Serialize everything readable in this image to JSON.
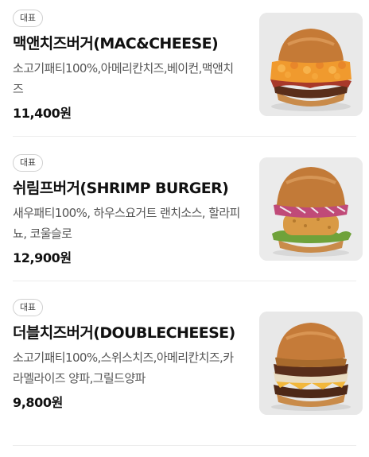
{
  "menu_items": [
    {
      "badge": "대표",
      "name": "맥앤치즈버거(MAC&CHEESE)",
      "description": "소고기패티100%,아메리칸치즈,베이컨,맥앤치즈",
      "price": "11,400원",
      "image_icon": "burger-mac-and-cheese-photo"
    },
    {
      "badge": "대표",
      "name": "쉬림프버거(SHRIMP BURGER)",
      "description": "새우패티100%, 하우스요거트 랜치소스, 할라피뇨, 코울슬로",
      "price": "12,900원",
      "image_icon": "burger-shrimp-photo"
    },
    {
      "badge": "대표",
      "name": "더블치즈버거(DOUBLECHEESE)",
      "description": "소고기패티100%,스위스치즈,아메리칸치즈,카라멜라이즈 양파,그릴드양파",
      "price": "9,800원",
      "image_icon": "burger-double-cheese-photo"
    }
  ]
}
